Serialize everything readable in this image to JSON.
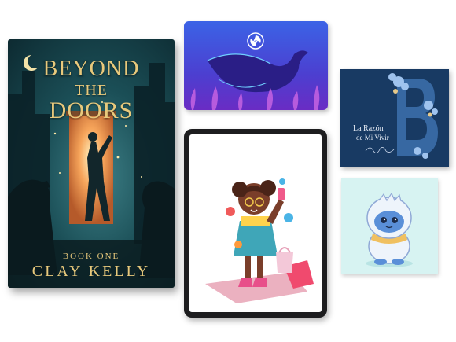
{
  "book": {
    "title_line1": "BEYOND",
    "title_line2": "THE",
    "title_line3": "DOORS",
    "series": "BOOK ONE",
    "author": "CLAY KELLY"
  },
  "razon": {
    "title_line1": "La Razón",
    "title_line2": "de Mi Vivir"
  },
  "colors": {
    "book_bg": "#1b4f57",
    "book_gold": "#e8c97c",
    "whale_sky": "#4c57d8",
    "razon_bg": "#183a63",
    "yeti_bg": "#d7f3f2"
  },
  "icons": {
    "whale_card_logo": "swirl-logo-icon"
  }
}
